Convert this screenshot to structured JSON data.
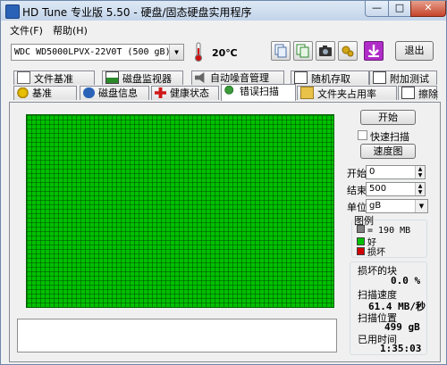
{
  "window": {
    "title": "HD Tune 专业版 5.50 - 硬盘/固态硬盘实用程序"
  },
  "menu": [
    {
      "label": "文件(F)"
    },
    {
      "label": "帮助(H)"
    }
  ],
  "toolbar": {
    "drive": "WDC WD5000LPVX-22V0T (500 gB)",
    "temperature": "20℃",
    "exit_label": "退出",
    "icons": [
      "copy-icon",
      "copy-all-icon",
      "screenshot-icon",
      "options-icon",
      "save-icon"
    ]
  },
  "tabs_row1": [
    {
      "label": "文件基准",
      "icon": "file-benchmark-icon"
    },
    {
      "label": "磁盘监视器",
      "icon": "disk-monitor-icon"
    },
    {
      "label": "自动噪音管理",
      "icon": "speaker-icon"
    },
    {
      "label": "随机存取",
      "icon": "random-access-icon"
    },
    {
      "label": "附加测试",
      "icon": "extra-tests-icon"
    }
  ],
  "tabs_row2": [
    {
      "label": "基准",
      "icon": "benchmark-icon"
    },
    {
      "label": "磁盘信息",
      "icon": "info-icon"
    },
    {
      "label": "健康状态",
      "icon": "health-icon"
    },
    {
      "label": "错误扫描",
      "icon": "error-scan-icon",
      "active": true
    },
    {
      "label": "文件夹占用率",
      "icon": "folder-icon"
    },
    {
      "label": "擦除",
      "icon": "erase-icon"
    }
  ],
  "scan": {
    "start_button": "开始",
    "quick_scan_label": "快速扫描",
    "quick_scan_checked": false,
    "speed_map_button": "速度图",
    "start_label": "开始",
    "start_value": "0",
    "end_label": "结束",
    "end_value": "500",
    "unit_label": "单位",
    "unit_value": "gB"
  },
  "legend": {
    "title": "图例",
    "block_size": "= 190 MB",
    "good": "好",
    "bad": "损坏",
    "colors": {
      "block": "#808080",
      "good": "#00c000",
      "bad": "#d00000"
    }
  },
  "stats": {
    "damaged_label": "损坏的块",
    "damaged_value": "0.0 %",
    "speed_label": "扫描速度",
    "speed_value": "61.4 MB/秒",
    "position_label": "扫描位置",
    "position_value": "499 gB",
    "elapsed_label": "已用时间",
    "elapsed_value": "1:35:03"
  },
  "colors": {
    "block_good": "#00c000",
    "title_bar": "#c2d4ea"
  }
}
